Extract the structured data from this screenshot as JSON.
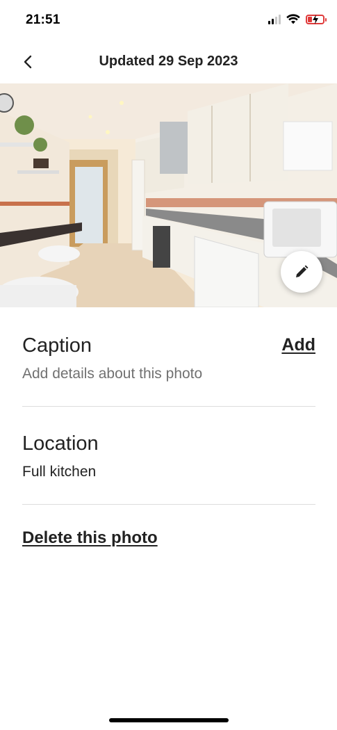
{
  "status_bar": {
    "time": "21:51",
    "icons": [
      "cellular-signal-icon",
      "wifi-icon",
      "battery-charging-icon"
    ],
    "battery_color": "#e03a3a"
  },
  "header": {
    "back_icon": "chevron-left-icon",
    "title": "Updated 29 Sep 2023"
  },
  "photo": {
    "subject": "kitchen photo",
    "edit_icon": "pencil-icon"
  },
  "caption": {
    "title": "Caption",
    "action": "Add",
    "placeholder": "Add details about this photo"
  },
  "location": {
    "title": "Location",
    "value": "Full kitchen"
  },
  "actions": {
    "delete_label": "Delete this photo"
  },
  "colors": {
    "text_primary": "#222222",
    "text_secondary": "#717171",
    "divider": "#dddddd"
  }
}
